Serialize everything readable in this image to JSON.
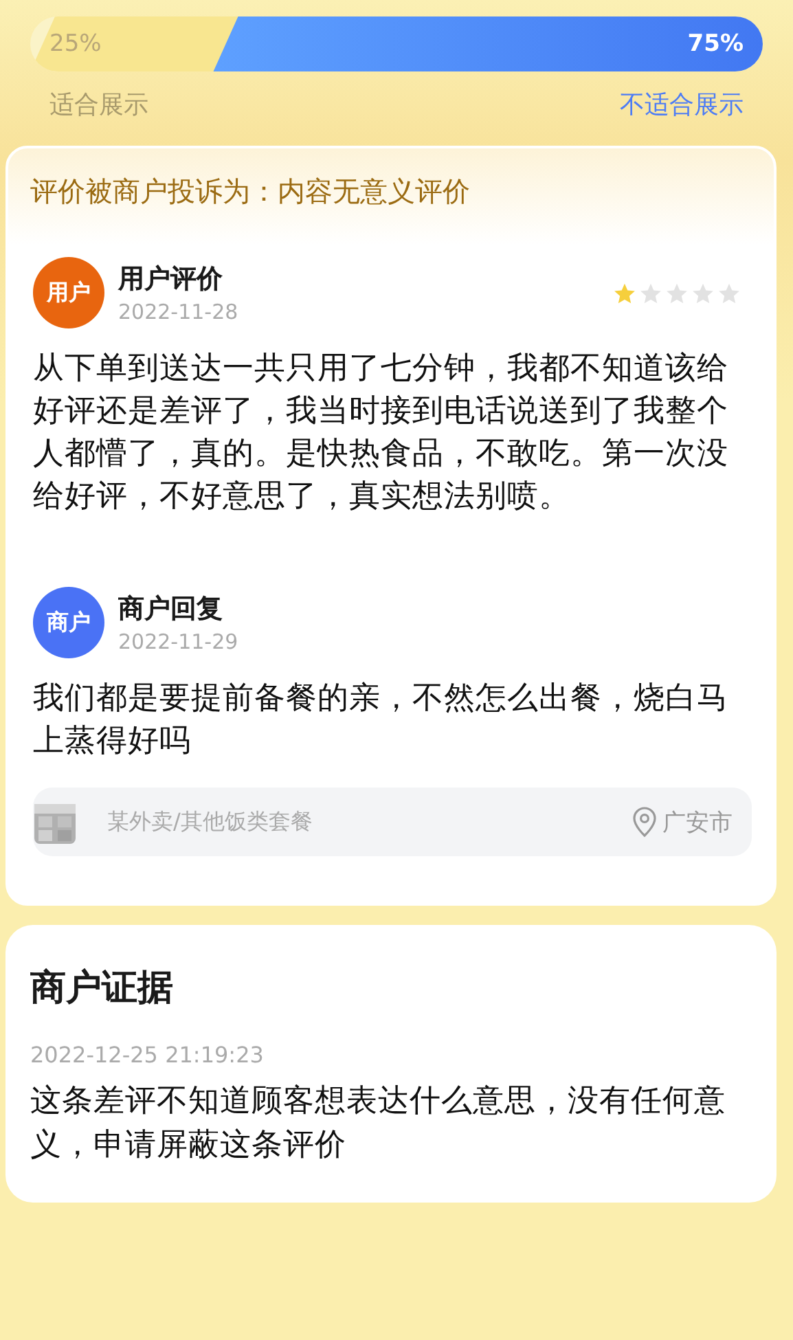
{
  "vote": {
    "level": 0.75,
    "left": {
      "reading": "25%",
      "label": "适合展示"
    },
    "right": {
      "reading": "75%",
      "label": "不适合展示"
    }
  },
  "complaint": {
    "title": "评价被商户投诉为：内容无意义评价",
    "posts": [
      {
        "kind": "user",
        "avatar": "用户",
        "color": "#e8650f",
        "title": "用户评价",
        "date": "2022-11-28",
        "stars": 1,
        "body": "从下单到送达一共只用了七分钟，我都不知道该给好评还是差评了，我当时接到电话说送到了我整个人都懵了，真的。是快热食品，不敢吃。第一次没给好评，不好意思了，真实想法别喷。"
      },
      {
        "kind": "merchant",
        "avatar": "商户",
        "color": "#4a72f5",
        "title": "商户回复",
        "date": "2022-11-29",
        "body": "我们都是要提前备餐的亲，不然怎么出餐，烧白马上蒸得好吗"
      }
    ],
    "store": {
      "name": "某外卖/其他饭类套餐",
      "location": "广安市"
    }
  },
  "evidence": {
    "title": "商户证据",
    "time": "2022-12-25 21:19:23",
    "body": "这条差评不知道顾客想表达什么意思，没有任何意义，申请屏蔽这条评价"
  }
}
